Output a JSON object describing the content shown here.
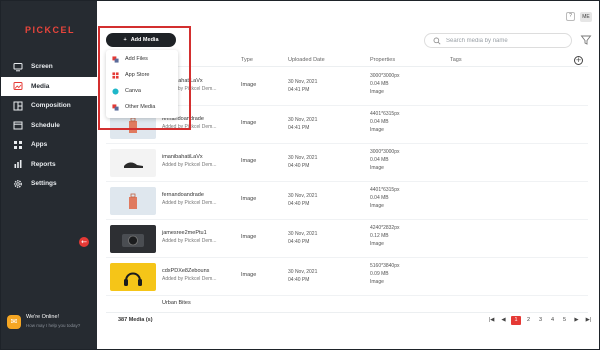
{
  "brand": {
    "logo_text": "PICKCEL",
    "logo_color": "#e8453c"
  },
  "sidebar": {
    "items": [
      {
        "label": "Screen",
        "icon": "monitor-icon"
      },
      {
        "label": "Media",
        "icon": "media-icon",
        "active": true
      },
      {
        "label": "Composition",
        "icon": "composition-icon"
      },
      {
        "label": "Schedule",
        "icon": "calendar-icon"
      },
      {
        "label": "Apps",
        "icon": "apps-grid-icon"
      },
      {
        "label": "Reports",
        "icon": "reports-icon"
      },
      {
        "label": "Settings",
        "icon": "gear-icon"
      }
    ],
    "collapse_icon": "arrow-left-icon",
    "chat": {
      "title": "We're Online!",
      "subtitle": "How may I help you today?",
      "icon": "chat-icon"
    }
  },
  "topbar": {
    "help_label": "?",
    "user_initials": "ME"
  },
  "toolbar": {
    "add_media_label": "Add Media",
    "search_placeholder": "Search media by name"
  },
  "dropdown": {
    "items": [
      {
        "label": "Add Files",
        "icon": "add-files-icon"
      },
      {
        "label": "App Store",
        "icon": "app-store-icon"
      },
      {
        "label": "Canva",
        "icon": "canva-icon"
      },
      {
        "label": "Other Media",
        "icon": "other-media-icon"
      }
    ]
  },
  "table": {
    "columns": {
      "type": "Type",
      "uploaded": "Uploaded Date",
      "properties": "Properties",
      "tags": "Tags"
    },
    "rows": [
      {
        "name": "imanibahatiLaVx",
        "added": "Added by Pickcel Dem...",
        "type": "Image",
        "date": "30 Nov, 2021",
        "time": "04:41 PM",
        "dims": "3000*3000px",
        "size": "0.04 MB",
        "kind": "Image",
        "thumb": "shoe"
      },
      {
        "name": "fernandoandrade",
        "added": "Added by Pickcel Dem...",
        "type": "Image",
        "date": "30 Nov, 2021",
        "time": "04:41 PM",
        "dims": "4401*6315px",
        "size": "0.04 MB",
        "kind": "Image",
        "thumb": "bag"
      },
      {
        "name": "imanibahatiLaVx",
        "added": "Added by Pickcel Dem...",
        "type": "Image",
        "date": "30 Nov, 2021",
        "time": "04:40 PM",
        "dims": "3000*3000px",
        "size": "0.04 MB",
        "kind": "Image",
        "thumb": "shoe"
      },
      {
        "name": "fernandoandrade",
        "added": "Added by Pickcel Dem...",
        "type": "Image",
        "date": "30 Nov, 2021",
        "time": "04:40 PM",
        "dims": "4401*6315px",
        "size": "0.04 MB",
        "kind": "Image",
        "thumb": "bag"
      },
      {
        "name": "jamesree2mePtu1",
        "added": "Added by Pickcel Dem...",
        "type": "Image",
        "date": "30 Nov, 2021",
        "time": "04:40 PM",
        "dims": "4240*2832px",
        "size": "0.12 MB",
        "kind": "Image",
        "thumb": "camera"
      },
      {
        "name": "cdxPDXe8Zebouns",
        "added": "Added by Pickcel Dem...",
        "type": "Image",
        "date": "30 Nov, 2021",
        "time": "04:40 PM",
        "dims": "5160*3840px",
        "size": "0.09 MB",
        "kind": "Image",
        "thumb": "headphones"
      },
      {
        "name": "Urban Bites",
        "added": "",
        "type": "",
        "date": "",
        "time": "",
        "dims": "",
        "size": "",
        "kind": "",
        "thumb": "blank"
      }
    ]
  },
  "footer": {
    "count_label": "387 Media (s)",
    "pages": [
      "1",
      "2",
      "3",
      "4",
      "5"
    ],
    "current_page": "1"
  },
  "colors": {
    "accent": "#e53935",
    "sidebar_bg": "#262b31",
    "highlight": "#d32f2f"
  }
}
